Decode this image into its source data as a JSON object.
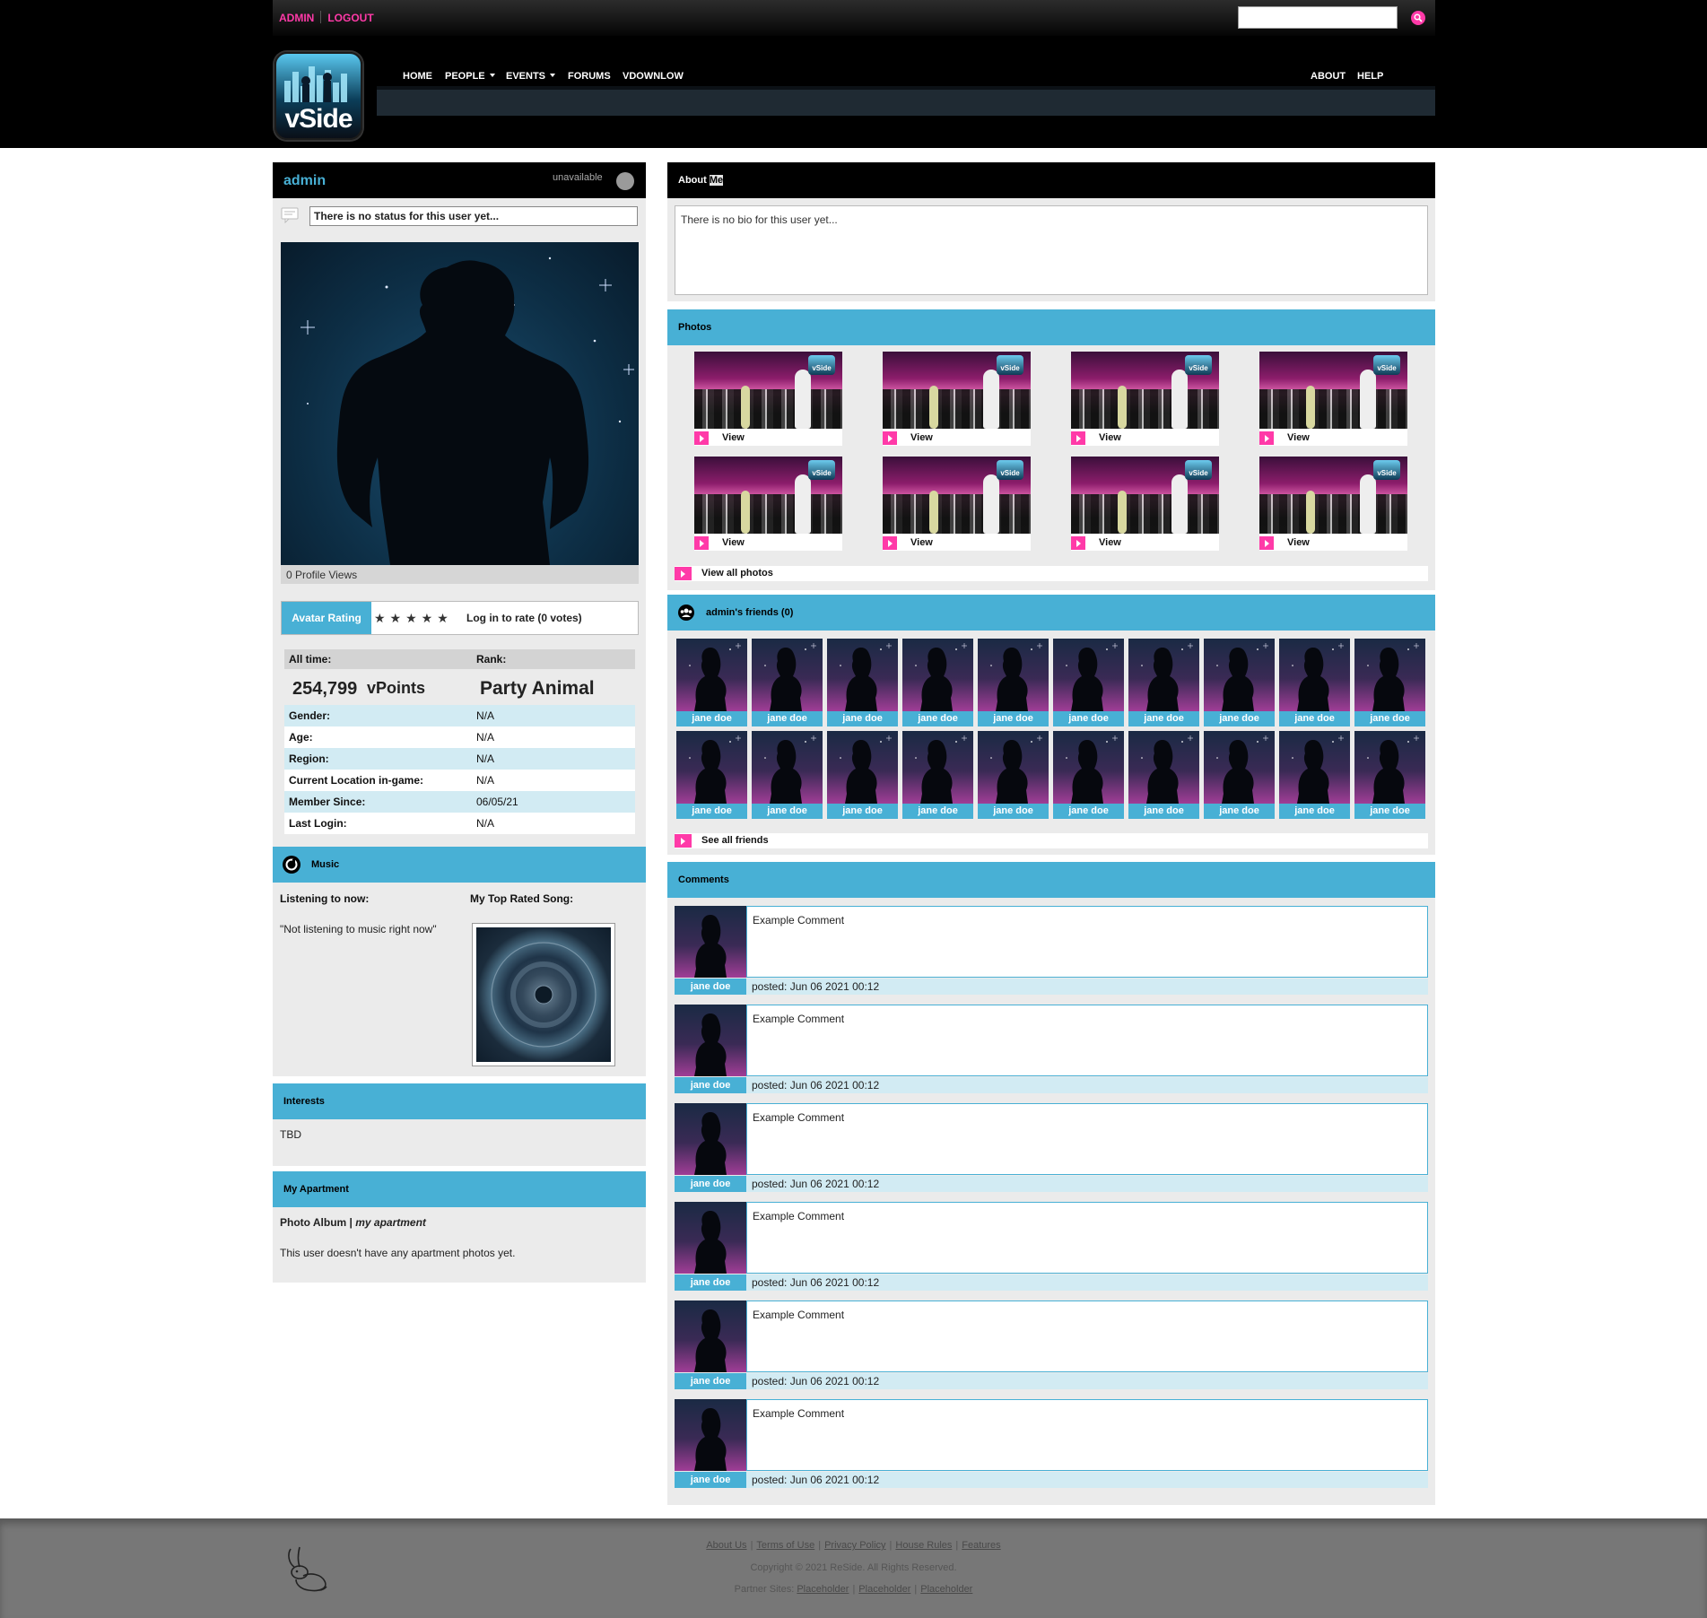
{
  "header": {
    "admin_link": "ADMIN",
    "logout_link": "LOGOUT",
    "search_placeholder": "",
    "search_icon": "search-icon",
    "logo_text": "vSide",
    "nav": {
      "home": "HOME",
      "people": "PEOPLE",
      "events": "EVENTS",
      "forums": "FORUMS",
      "vdownload": "VDOWNLOW",
      "about": "ABOUT",
      "help": "HELP"
    }
  },
  "profile": {
    "username": "admin",
    "presence": "unavailable",
    "status": "There is no status for this user yet...",
    "views": "0 Profile Views",
    "rating": {
      "label": "Avatar Rating",
      "stars": "★★★★★",
      "login_text": "Log in to rate (0 votes)"
    },
    "stats_header": {
      "alltime": "All time:",
      "rank": "Rank:"
    },
    "vpoints": "254,799",
    "vpoints_unit": "vPoints",
    "rank": "Party Animal",
    "rows": [
      {
        "k": "Gender:",
        "v": "N/A"
      },
      {
        "k": "Age:",
        "v": "N/A"
      },
      {
        "k": "Region:",
        "v": "N/A"
      },
      {
        "k": "Current Location in-game:",
        "v": "N/A"
      },
      {
        "k": "Member Since:",
        "v": "06/05/21"
      },
      {
        "k": "Last Login:",
        "v": "N/A"
      }
    ]
  },
  "music": {
    "title": "Music",
    "listening_label": "Listening to now:",
    "top_song_label": "My Top Rated Song:",
    "listening_value": "\"Not listening to music right now\""
  },
  "interests": {
    "title": "Interests",
    "value": "TBD"
  },
  "apartment": {
    "title": "My Apartment",
    "album_prefix": "Photo Album | ",
    "album_name": "my apartment",
    "empty_text": "This user doesn't have any apartment photos yet."
  },
  "about": {
    "title_prefix": "About ",
    "title_highlight": "Me",
    "bio": "There is no bio for this user yet..."
  },
  "photos": {
    "title": "Photos",
    "view_label": "View",
    "badge": "vSide",
    "count": 8,
    "view_all": "View all photos"
  },
  "friends": {
    "title": "admin's friends (0)",
    "friend_name": "jane doe",
    "count": 20,
    "see_all": "See all friends"
  },
  "comments": {
    "title": "Comments",
    "items": [
      {
        "name": "jane doe",
        "text": "Example Comment",
        "posted": "posted: Jun 06 2021 00:12"
      },
      {
        "name": "jane doe",
        "text": "Example Comment",
        "posted": "posted: Jun 06 2021 00:12"
      },
      {
        "name": "jane doe",
        "text": "Example Comment",
        "posted": "posted: Jun 06 2021 00:12"
      },
      {
        "name": "jane doe",
        "text": "Example Comment",
        "posted": "posted: Jun 06 2021 00:12"
      },
      {
        "name": "jane doe",
        "text": "Example Comment",
        "posted": "posted: Jun 06 2021 00:12"
      },
      {
        "name": "jane doe",
        "text": "Example Comment",
        "posted": "posted: Jun 06 2021 00:12"
      }
    ]
  },
  "footer": {
    "links": [
      "About Us",
      "Terms of Use",
      "Privacy Policy",
      "House Rules",
      "Features"
    ],
    "copyright": "Copyright © 2021 ReSide. All Rights Reserved.",
    "partners_label": "Partner Sites:",
    "partners": [
      "Placeholder",
      "Placeholder",
      "Placeholder"
    ]
  }
}
